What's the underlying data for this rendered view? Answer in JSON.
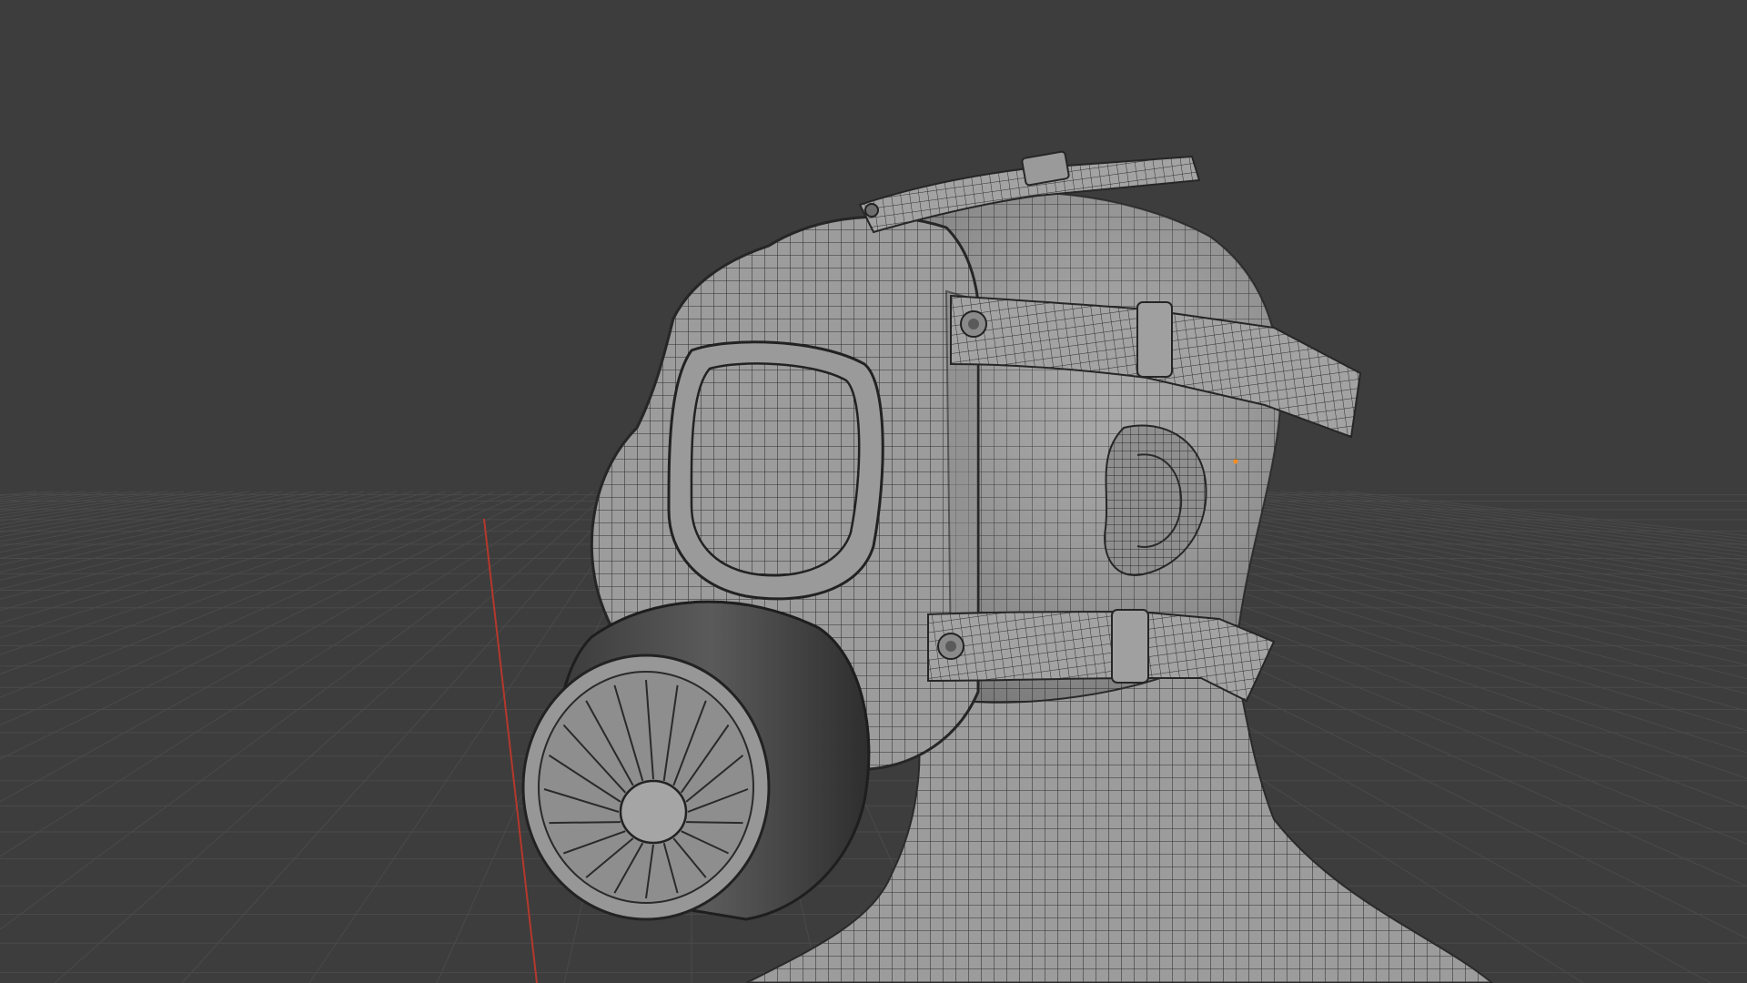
{
  "viewport": {
    "mode": "3D viewport",
    "shading": "solid",
    "overlay": "wireframe",
    "background_color": "#3d3d3d",
    "grid_line_color": "#4a4a4a",
    "x_axis_color": "#c0392b",
    "mesh_color": "#9a9a9a",
    "wire_color": "#2a2a2a",
    "origin_marker_color": "#ff8c1a"
  },
  "scene": {
    "object": "gas-mask-on-head",
    "parts": [
      "head-and-neck",
      "mask-faceplate",
      "eyepiece",
      "filter-canister",
      "upper-strap",
      "lower-strap",
      "top-strap",
      "ear"
    ]
  }
}
